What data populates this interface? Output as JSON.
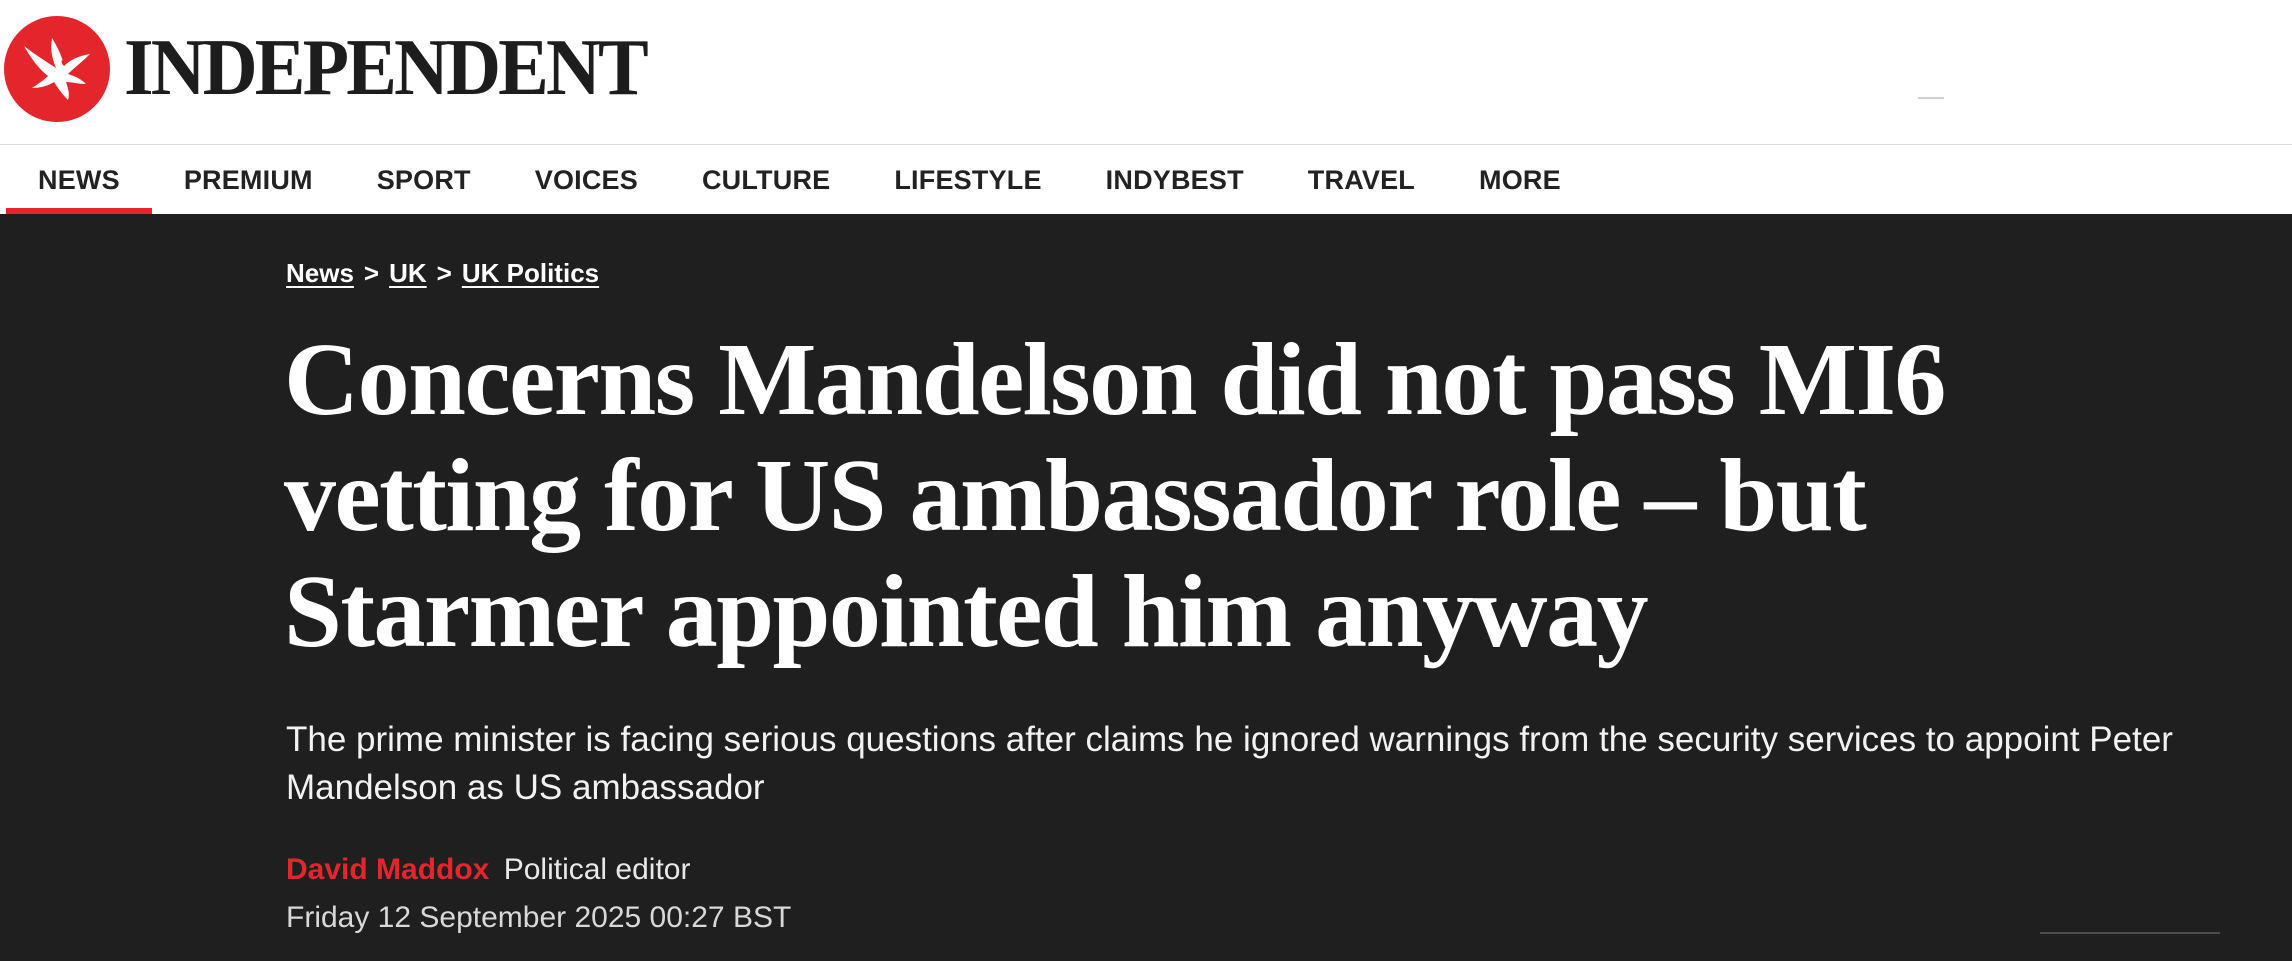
{
  "masthead": {
    "wordmark": "INDEPENDENT",
    "logo_icon": "eagle-icon",
    "brand_color": "#e4262c"
  },
  "nav": {
    "items": [
      {
        "label": "NEWS",
        "active": true
      },
      {
        "label": "PREMIUM",
        "active": false
      },
      {
        "label": "SPORT",
        "active": false
      },
      {
        "label": "VOICES",
        "active": false
      },
      {
        "label": "CULTURE",
        "active": false
      },
      {
        "label": "LIFESTYLE",
        "active": false
      },
      {
        "label": "INDYBEST",
        "active": false
      },
      {
        "label": "TRAVEL",
        "active": false
      },
      {
        "label": "MORE",
        "active": false
      }
    ]
  },
  "breadcrumb": {
    "items": [
      "News",
      "UK",
      "UK Politics"
    ],
    "separator": ">"
  },
  "article": {
    "headline": "Concerns Mandelson did not pass MI6 vetting for US ambassador role – but Starmer appointed him anyway",
    "standfirst": "The prime minister is facing serious questions after claims he ignored warnings from the security services to appoint Peter Mandelson as US ambassador",
    "author": "David Maddox",
    "author_role": "Political editor",
    "published": "Friday 12 September 2025 00:27 BST"
  },
  "colors": {
    "hero_background": "#1f1f1f",
    "accent": "#e4262c",
    "text_on_dark": "#ffffff"
  }
}
